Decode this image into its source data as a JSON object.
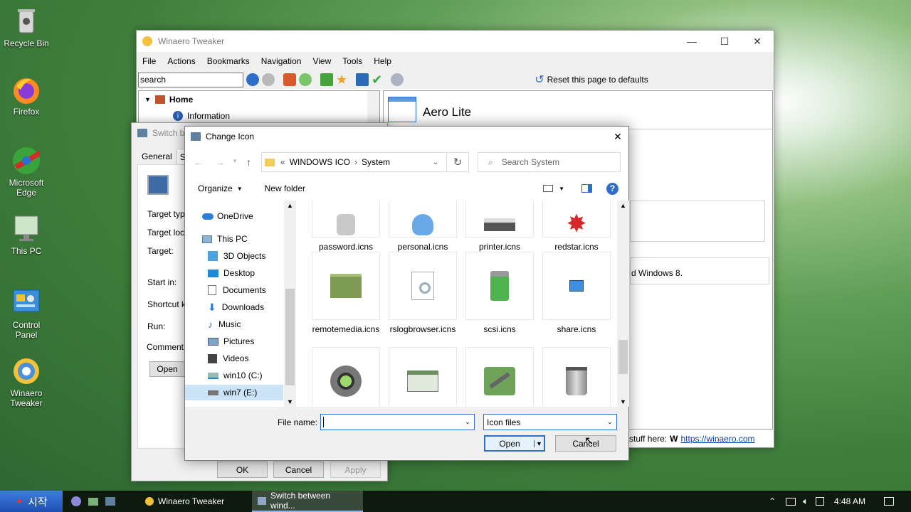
{
  "desktop": {
    "icons": [
      {
        "label": "Recycle Bin"
      },
      {
        "label": "Firefox"
      },
      {
        "label": "Microsoft Edge"
      },
      {
        "label": "This PC"
      },
      {
        "label": "Control Panel"
      },
      {
        "label": "Winaero Tweaker"
      }
    ]
  },
  "tweaker": {
    "title": "Winaero Tweaker",
    "menu": [
      "File",
      "Actions",
      "Bookmarks",
      "Navigation",
      "View",
      "Tools",
      "Help"
    ],
    "search_value": "search",
    "reset_label": "Reset this page to defaults",
    "tree_home": "Home",
    "tree_info": "Information",
    "page_title": "Aero Lite",
    "body_text": "d Windows 8.",
    "footer_text": "stuff here:",
    "footer_link": "https://winaero.com"
  },
  "shortcut_props": {
    "title": "Switch b",
    "tab_general": "General",
    "tab_shortcut": "Sh",
    "labels": [
      "Target typ",
      "Target loc",
      "Target:",
      "Start in:",
      "Shortcut k",
      "Run:",
      "Comment:"
    ],
    "open_btn": "Open",
    "ok": "OK",
    "cancel": "Cancel",
    "apply": "Apply"
  },
  "dialog": {
    "title": "Change Icon",
    "breadcrumb_prefix": "«",
    "breadcrumb": [
      "WINDOWS ICO",
      "System"
    ],
    "search_placeholder": "Search System",
    "organize": "Organize",
    "new_folder": "New folder",
    "nav": [
      {
        "label": "OneDrive"
      },
      {
        "label": "This PC"
      },
      {
        "label": "3D Objects"
      },
      {
        "label": "Desktop"
      },
      {
        "label": "Documents"
      },
      {
        "label": "Downloads"
      },
      {
        "label": "Music"
      },
      {
        "label": "Pictures"
      },
      {
        "label": "Videos"
      },
      {
        "label": "win10 (C:)"
      },
      {
        "label": "win7 (E:)"
      }
    ],
    "files_row1": [
      "password.icns",
      "personal.icns",
      "printer.icns",
      "redstar.icns"
    ],
    "files_row2": [
      "remotemedia.icns",
      "rslogbrowser.icns",
      "scsi.icns",
      "share.icns"
    ],
    "filename_label": "File name:",
    "filename_value": "",
    "filetype": "Icon files",
    "open": "Open",
    "cancel": "Cancel"
  },
  "taskbar": {
    "start": "시작",
    "tasks": [
      "Winaero Tweaker",
      "Switch between wind..."
    ],
    "time": "4:48 AM"
  }
}
